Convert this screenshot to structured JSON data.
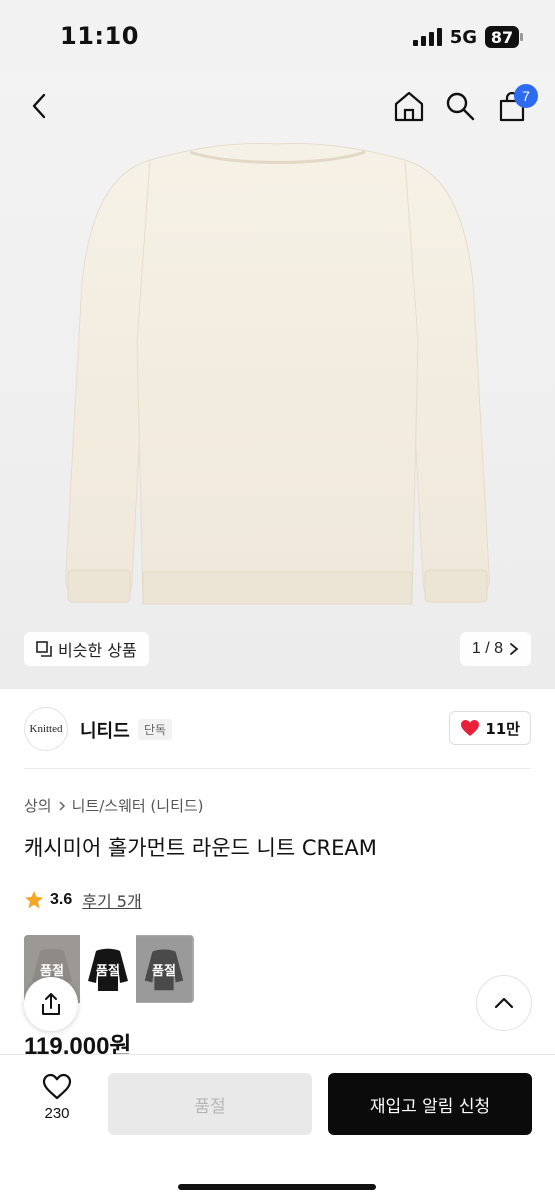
{
  "status_bar": {
    "time": "11:10",
    "network": "5G",
    "battery": "87"
  },
  "header": {
    "cart_count": "7"
  },
  "gallery": {
    "similar_label": "비슷한 상품",
    "page_indicator": "1 / 8"
  },
  "brand": {
    "logo_text": "Knitted",
    "name": "니티드",
    "tag": "단독",
    "likes": "11만"
  },
  "breadcrumb": {
    "category": "상의",
    "subcategory": "니트/스웨터 (니티드)"
  },
  "product": {
    "title": "캐시미어 홀가먼트 라운드 니트 CREAM",
    "rating": "3.6",
    "review_link": "후기 5개",
    "price": "119,000원",
    "swatches": [
      {
        "label": "품절",
        "color": "#8e8a86"
      },
      {
        "label": "품절",
        "color": "#151515"
      },
      {
        "label": "품절",
        "color": "#4a4a4a"
      }
    ]
  },
  "bottom_bar": {
    "wish_count": "230",
    "soldout_label": "품절",
    "restock_label": "재입고 알림 신청"
  },
  "colors": {
    "accent_badge": "#2d6cf0",
    "heart": "#e8203b",
    "primary_button": "#0b0b0b"
  },
  "icons": [
    "back-icon",
    "home-icon",
    "search-icon",
    "cart-icon",
    "similar-icon",
    "chevron-right-icon",
    "heart-icon",
    "star-icon",
    "share-icon",
    "chevron-up-icon"
  ]
}
